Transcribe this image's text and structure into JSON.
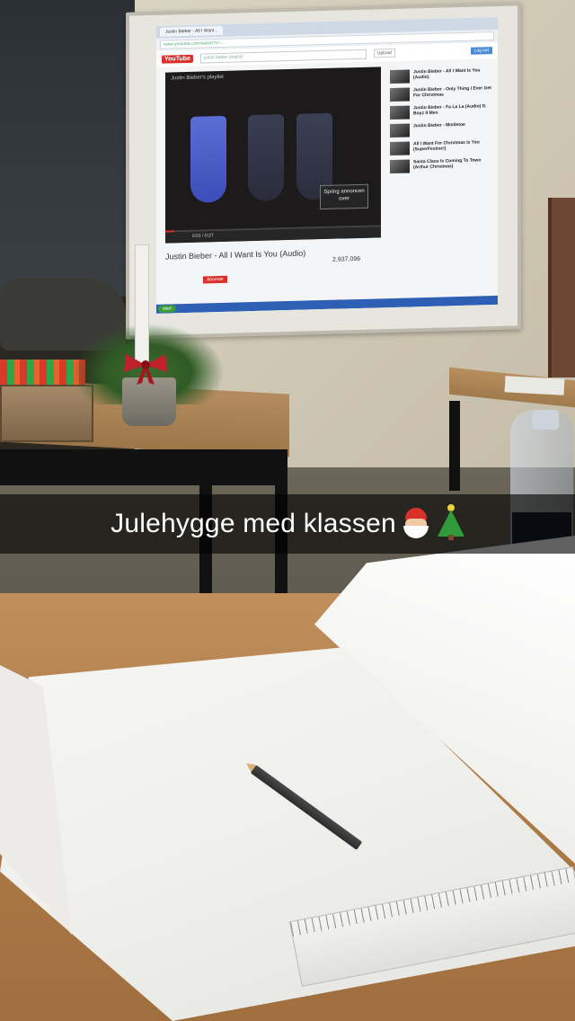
{
  "photo": {
    "caption": "Julehygge med klassen",
    "caption_emojis": [
      "santa-face-icon",
      "christmas-tree-icon"
    ],
    "colors": {
      "caption_bar": "#000000",
      "caption_text": "#ffffff",
      "desk_wood": "#b07d48"
    }
  },
  "projected_screen": {
    "browser": {
      "tab": "Justin Bieber - All I Want...",
      "url": "www.youtube.com/watch?v=..."
    },
    "youtube": {
      "logo": "YouTube",
      "search": "justin bieber playlist",
      "upload_label": "Upload",
      "login_label": "Log ind",
      "playlist_title": "Justin Bieber's playlist",
      "video_title": "Justin Bieber - All I Want Is You (Audio)",
      "views": "2,937,096",
      "subscribe_label": "Abonner",
      "skip_ad": "Spring annoncen over",
      "time": "0:01 / 0:27",
      "progress": 0.04,
      "sidebar_items": [
        "Justin Bieber - All I Want Is You (Audio)",
        "Justin Bieber - Only Thing I Ever Get For Christmas",
        "Justin Bieber - Fa La La (Audio) ft. Boyz II Men",
        "Justin Bieber - Mistletoe",
        "All I Want For Christmas Is You (SuperFestive!)",
        "Santa Claus Is Coming To Town (Arthur Christmas)"
      ]
    },
    "taskbar": {
      "start_label": "start"
    }
  }
}
